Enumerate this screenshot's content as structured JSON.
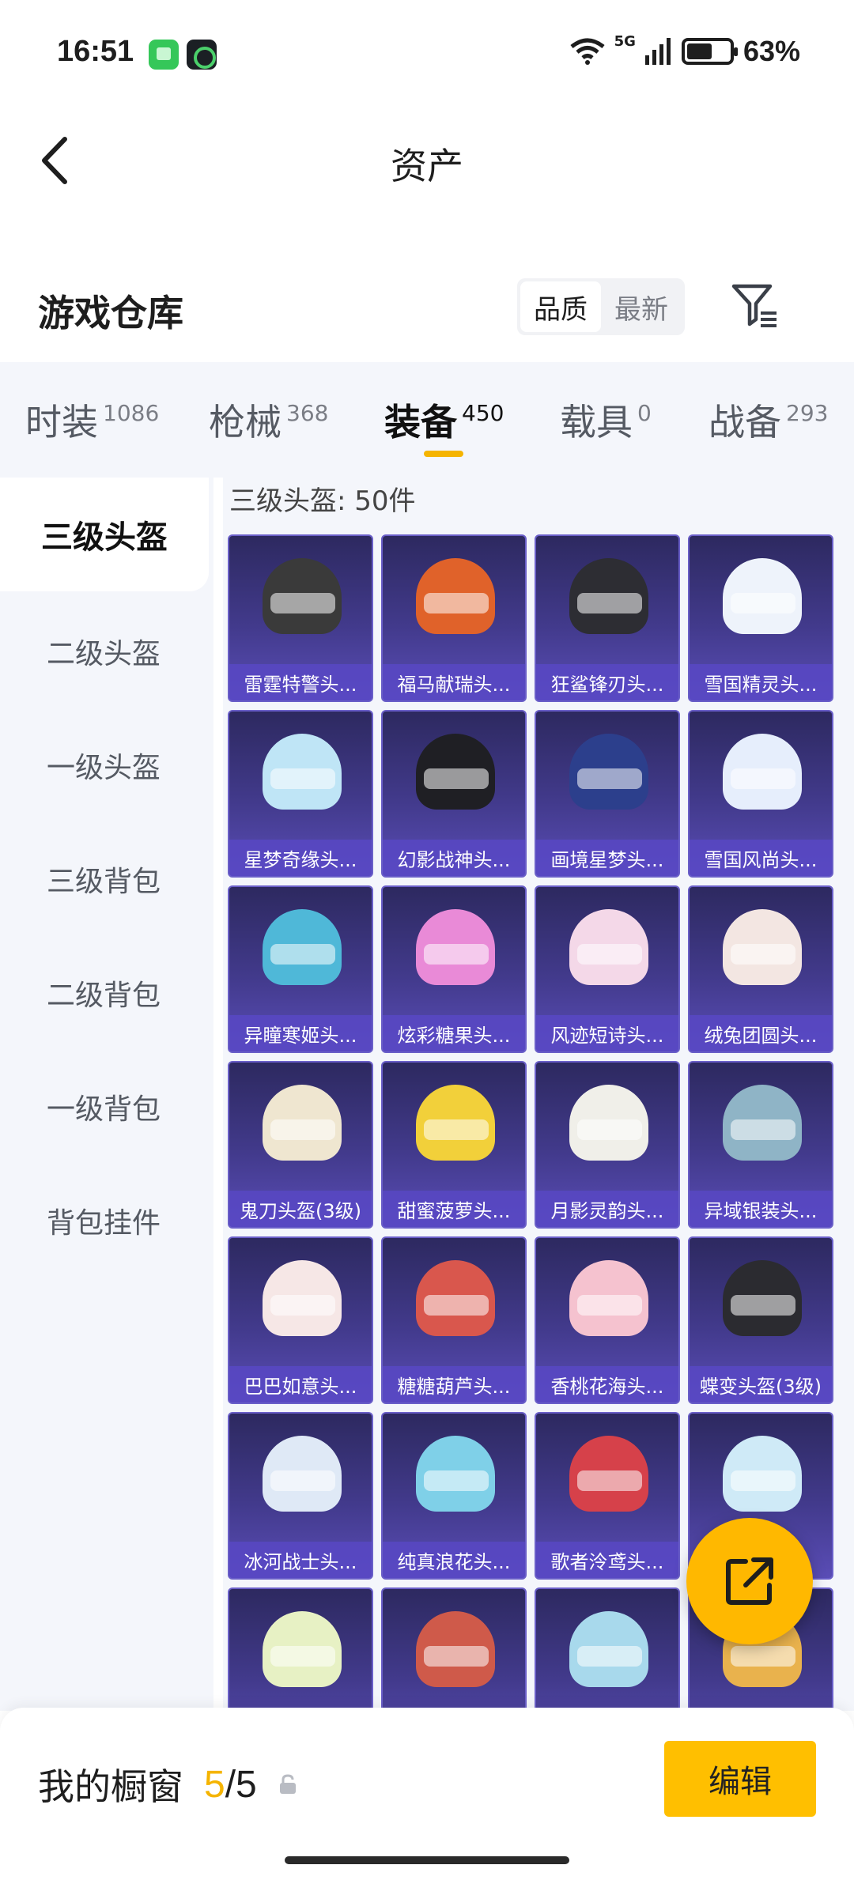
{
  "status_bar": {
    "time": "16:51",
    "network": "5G",
    "battery_percent": "63%",
    "battery_level": 0.63
  },
  "header": {
    "title": "资产",
    "back_icon": "chevron-left-icon"
  },
  "warehouse": {
    "title": "游戏仓库",
    "sort_options": [
      "品质",
      "最新"
    ],
    "sort_selected": "品质",
    "filter_icon": "filter-icon"
  },
  "tabs": [
    {
      "label": "时装",
      "count": "1086"
    },
    {
      "label": "枪械",
      "count": "368"
    },
    {
      "label": "装备",
      "count": "450",
      "active": true
    },
    {
      "label": "载具",
      "count": "0"
    },
    {
      "label": "战备",
      "count": "293"
    }
  ],
  "sidebar": {
    "items": [
      {
        "label": "三级头盔",
        "active": true
      },
      {
        "label": "二级头盔"
      },
      {
        "label": "一级头盔"
      },
      {
        "label": "三级背包"
      },
      {
        "label": "二级背包"
      },
      {
        "label": "一级背包"
      },
      {
        "label": "背包挂件"
      }
    ]
  },
  "grid": {
    "count_label": "三级头盔: 50件",
    "items": [
      {
        "name": "雷霆特警头...",
        "color": "#3a3a3a"
      },
      {
        "name": "福马献瑞头...",
        "color": "#e0622a"
      },
      {
        "name": "狂鲨锋刃头...",
        "color": "#2d2d33"
      },
      {
        "name": "雪国精灵头...",
        "color": "#eef3fb"
      },
      {
        "name": "星梦奇缘头...",
        "color": "#bfe5f6"
      },
      {
        "name": "幻影战神头...",
        "color": "#1f1f24"
      },
      {
        "name": "画境星梦头...",
        "color": "#2c3f8c"
      },
      {
        "name": "雪国风尚头...",
        "color": "#e6eefc"
      },
      {
        "name": "异瞳寒姬头...",
        "color": "#4fb8d8"
      },
      {
        "name": "炫彩糖果头...",
        "color": "#e98ad7"
      },
      {
        "name": "风迹短诗头...",
        "color": "#f4d8e8"
      },
      {
        "name": "绒兔团圆头...",
        "color": "#f3e6e2"
      },
      {
        "name": "鬼刀头盔(3级)",
        "color": "#efe6d0"
      },
      {
        "name": "甜蜜菠萝头...",
        "color": "#f2d03a"
      },
      {
        "name": "月影灵韵头...",
        "color": "#f0efe9"
      },
      {
        "name": "异域银装头...",
        "color": "#8fb4c6"
      },
      {
        "name": "巴巴如意头...",
        "color": "#f6e7e6"
      },
      {
        "name": "糖糖葫芦头...",
        "color": "#d9574d"
      },
      {
        "name": "香桃花海头...",
        "color": "#f5c2cf"
      },
      {
        "name": "蝶变头盔(3级)",
        "color": "#2b2b30"
      },
      {
        "name": "冰河战士头...",
        "color": "#dfe9f6"
      },
      {
        "name": "纯真浪花头...",
        "color": "#7fd0e8"
      },
      {
        "name": "歌者泠鸢头...",
        "color": "#d6414a"
      },
      {
        "name": "",
        "color": "#cfeaf7"
      },
      {
        "name": "",
        "color": "#e7f1c4"
      },
      {
        "name": "",
        "color": "#cf5a4a"
      },
      {
        "name": "",
        "color": "#a8d9ec"
      },
      {
        "name": "",
        "color": "#e9b24d"
      }
    ]
  },
  "fab": {
    "icon": "share-icon"
  },
  "bottom_bar": {
    "label": "我的橱窗",
    "current": "5",
    "separator": "/",
    "total": "5",
    "lock_icon": "lock-icon",
    "edit_label": "编辑"
  }
}
